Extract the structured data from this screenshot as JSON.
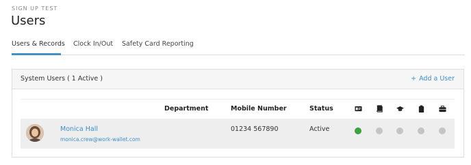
{
  "header": {
    "org_name": "SIGN UP TEST",
    "title": "Users"
  },
  "tabs": [
    {
      "label": "Users & Records",
      "active": true
    },
    {
      "label": "Clock In/Out",
      "active": false
    },
    {
      "label": "Safety Card Reporting",
      "active": false
    }
  ],
  "panel": {
    "title": "System Users ( 1 Active )",
    "add_user_label": "Add a User",
    "add_user_icon": "plus-icon"
  },
  "table": {
    "columns": [
      "Department",
      "Mobile Number",
      "Status"
    ],
    "icon_columns": [
      "id-card-icon",
      "book-icon",
      "graduation-cap-icon",
      "clipboard-icon",
      "briefcase-icon"
    ],
    "rows": [
      {
        "name": "Monica Hall",
        "email": "monica.crew@work-wallet.com",
        "department": "",
        "mobile": "01234 567890",
        "status": "Active",
        "indicators": [
          "green",
          "grey",
          "grey",
          "grey",
          "grey"
        ]
      }
    ]
  },
  "colors": {
    "accent": "#3f8fc9",
    "indicator_green": "#3fa142",
    "indicator_grey": "#c4c4c4"
  }
}
